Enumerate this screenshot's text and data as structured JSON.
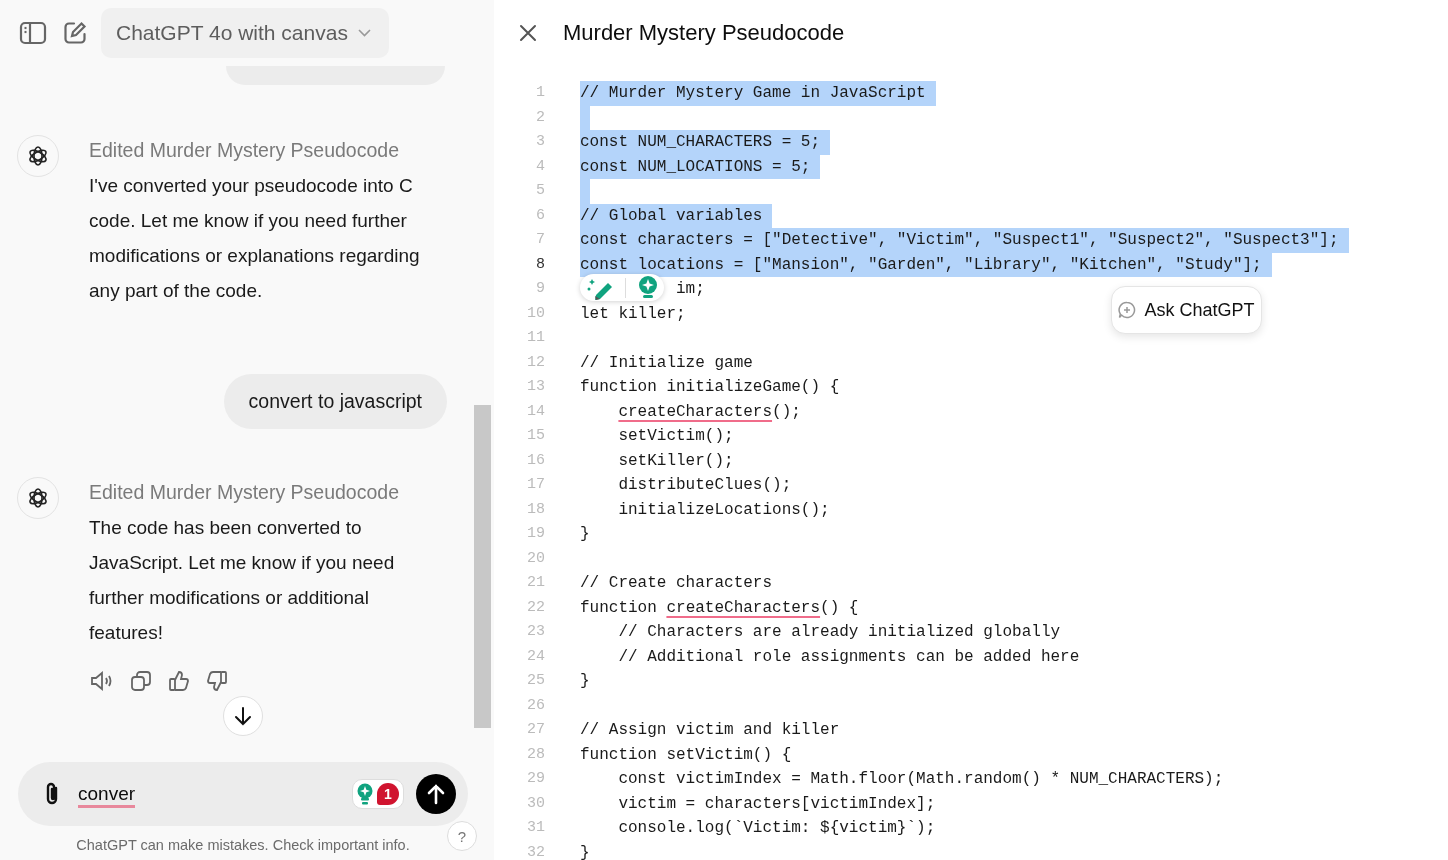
{
  "header": {
    "model": "ChatGPT 4o with canvas"
  },
  "messages": [
    {
      "kind": "bubble-edge"
    },
    {
      "kind": "assistant",
      "title": "Edited Murder Mystery Pseudocode",
      "text": "I've converted your pseudocode into C code. Let me know if you need further modifications or explanations regarding any part of the code."
    },
    {
      "kind": "user",
      "text": "convert to javascript"
    },
    {
      "kind": "assistant",
      "title": "Edited Murder Mystery Pseudocode",
      "text": "The code has been converted to JavaScript. Let me know if you need further modifications or additional features!"
    }
  ],
  "composer": {
    "value": "conver",
    "misspelled": true,
    "badge": "1"
  },
  "disclaimer": "ChatGPT can make mistakes. Check important info.",
  "help": "?",
  "canvas": {
    "title": "Murder Mystery Pseudocode",
    "ask_button": "Ask ChatGPT",
    "lines": [
      {
        "number": "1",
        "text": "// Murder Mystery Game in JavaScript",
        "selected": true,
        "current": false
      },
      {
        "number": "2",
        "selected": true,
        "current": false
      },
      {
        "number": "3",
        "text": "const NUM_CHARACTERS = 5;",
        "selected": true,
        "current": false
      },
      {
        "number": "4",
        "text": "const NUM_LOCATIONS = 5;",
        "selected": true,
        "current": false
      },
      {
        "number": "5",
        "selected": true,
        "current": false
      },
      {
        "number": "6",
        "text": "// Global variables",
        "selected": true,
        "current": false
      },
      {
        "number": "7",
        "text": "const characters = [\"Detective\", \"Victim\", \"Suspect1\", \"Suspect2\", \"Suspect3\"];",
        "selected": true,
        "current": false
      },
      {
        "number": "8",
        "text": "const locations = [\"Mansion\", \"Garden\", \"Library\", \"Kitchen\", \"Study\"];",
        "selected": true,
        "current": true
      },
      {
        "number": "9",
        "after_toolbar": "im;",
        "selected": false,
        "current": false
      },
      {
        "number": "10",
        "text": "let killer;",
        "selected": false,
        "current": false
      },
      {
        "number": "11",
        "selected": false,
        "current": false
      },
      {
        "number": "12",
        "text": "// Initialize game",
        "selected": false,
        "current": false
      },
      {
        "number": "13",
        "text": "function initializeGame() {",
        "selected": false,
        "current": false
      },
      {
        "number": "14",
        "indented": true,
        "flagged": "createCharacters",
        "rest": "();",
        "selected": false,
        "current": false
      },
      {
        "number": "15",
        "text": "    setVictim();",
        "selected": false,
        "current": false
      },
      {
        "number": "16",
        "text": "    setKiller();",
        "selected": false,
        "current": false
      },
      {
        "number": "17",
        "text": "    distributeClues();",
        "selected": false,
        "current": false
      },
      {
        "number": "18",
        "text": "    initializeLocations();",
        "selected": false,
        "current": false
      },
      {
        "number": "19",
        "text": "}",
        "selected": false,
        "current": false
      },
      {
        "number": "20",
        "selected": false,
        "current": false
      },
      {
        "number": "21",
        "text": "// Create characters",
        "selected": false,
        "current": false
      },
      {
        "number": "22",
        "text": "function ",
        "flagged": "createCharacters",
        "rest": "() {",
        "selected": false,
        "current": false
      },
      {
        "number": "23",
        "text": "    // Characters are already initialized globally",
        "selected": false,
        "current": false
      },
      {
        "number": "24",
        "text": "    // Additional role assignments can be added here",
        "selected": false,
        "current": false
      },
      {
        "number": "25",
        "text": "}",
        "selected": false,
        "current": false
      },
      {
        "number": "26",
        "selected": false,
        "current": false
      },
      {
        "number": "27",
        "text": "// Assign victim and killer",
        "selected": false,
        "current": false
      },
      {
        "number": "28",
        "text": "function setVictim() {",
        "selected": false,
        "current": false
      },
      {
        "number": "29",
        "text": "    const victimIndex = Math.floor(Math.random() * NUM_CHARACTERS);",
        "selected": false,
        "current": false
      },
      {
        "number": "30",
        "text": "    victim = characters[victimIndex];",
        "selected": false,
        "current": false
      },
      {
        "number": "31",
        "text": "    console.log(`Victim: ${victim}`);",
        "selected": false,
        "current": false
      },
      {
        "number": "32",
        "text": "}",
        "selected": false,
        "current": false
      }
    ]
  }
}
